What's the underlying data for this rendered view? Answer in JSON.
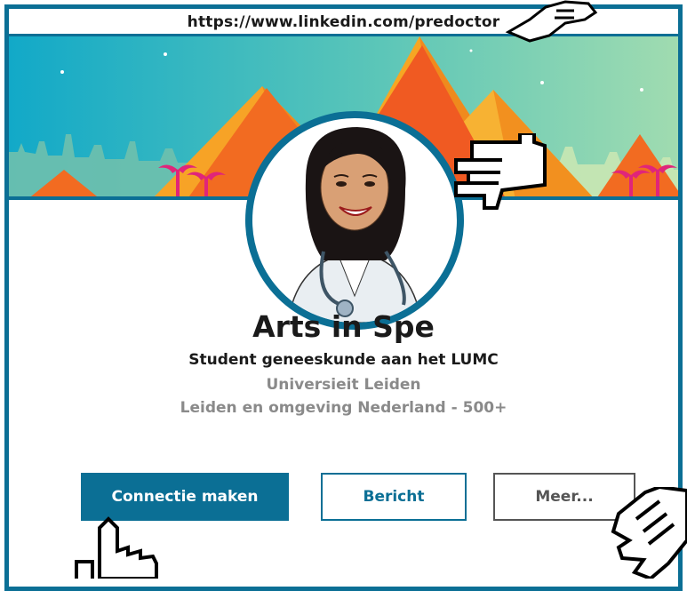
{
  "url": "https://www.linkedin.com/predoctor",
  "profile": {
    "name": "Arts in Spe",
    "headline": "Student geneeskunde aan het LUMC",
    "school": "Universieit Leiden",
    "location": "Leiden en omgeving Nederland - 500+"
  },
  "actions": {
    "connect_label": "Connectie maken",
    "message_label": "Bericht",
    "more_label": "Meer..."
  },
  "colors": {
    "accent": "#0b6f95",
    "banner_sky": "#2fb8c9",
    "pyramid": "#f26b21"
  },
  "icons": [
    "hand-pointer-icon",
    "avatar-doctor-illustration"
  ]
}
